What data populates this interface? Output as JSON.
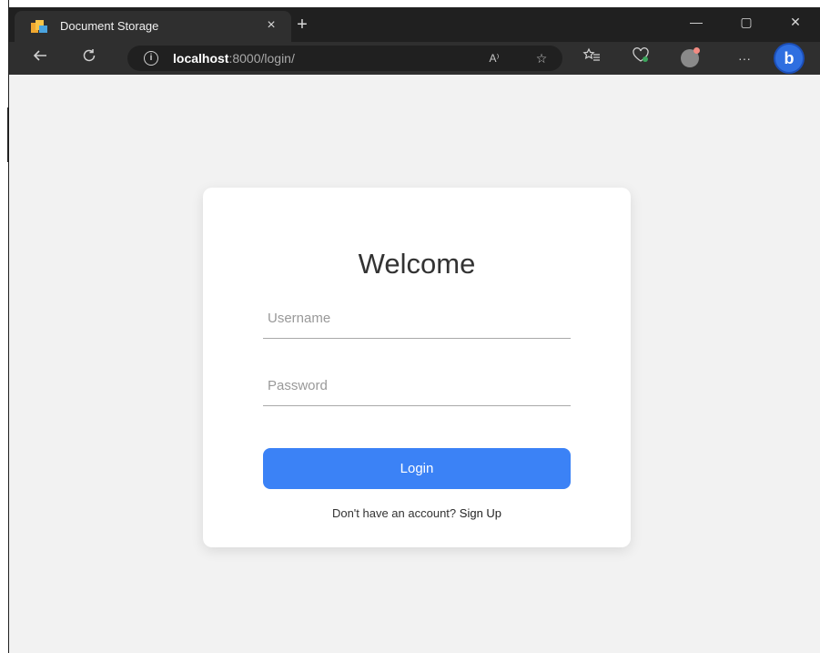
{
  "browser": {
    "tab_title": "Document Storage",
    "tab_close": "×",
    "new_tab": "+",
    "window_minimize": "—",
    "window_maximize": "▢",
    "window_close": "✕",
    "address_host": "localhost",
    "address_path": ":8000/login/",
    "more_menu": "···",
    "read_aloud_icon": "A⁾"
  },
  "page": {
    "title": "Welcome",
    "username_placeholder": "Username",
    "password_placeholder": "Password",
    "login_label": "Login",
    "signup_prompt": "Don't have an account?",
    "signup_link": "Sign Up"
  },
  "colors": {
    "accent": "#3b82f6",
    "background": "#f2f2f2"
  }
}
